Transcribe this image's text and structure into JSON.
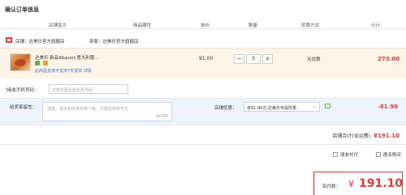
{
  "page": {
    "title": "确认订单信息"
  },
  "table_header": {
    "columns": [
      "店铺宝贝",
      "商品属性",
      "单价",
      "数量",
      "优惠方式",
      "小计"
    ]
  },
  "shop": {
    "store_label": "店铺：达美乐官方旗舰店",
    "seller_label": "卖家：达美乐官方旗舰店"
  },
  "item": {
    "name": "达美乐 新品9&quot;意大利蕾...",
    "return_note": "此商品支持不支持7天退货",
    "return_detail": "详情",
    "unit_price": "91.00",
    "quantity": "3",
    "minus_label": "−",
    "plus_label": "+",
    "promo": "无优惠",
    "subtotal": "273.00"
  },
  "phone": {
    "required_mark": "*",
    "label": "接收手机号码：",
    "placeholder": "仅限中国大陆手机号码"
  },
  "message": {
    "label": "给卖家留言：",
    "placeholder": "选填，请先和商家协商一致，付款后商家可见",
    "count": "0/200"
  },
  "coupon": {
    "label": "店铺优惠：",
    "selected": "省81.90元:达美乐专属优惠",
    "discount": "-81.90"
  },
  "shop_total": {
    "label": "店铺合计(含运费)",
    "amount": "¥191.10"
  },
  "options": {
    "friend_pay": "朋友代付",
    "anonymous": "匿名购买"
  },
  "payment": {
    "label": "实付款：",
    "currency": "¥",
    "amount": "191.10"
  },
  "colors": {
    "accent_red": "#e4393c",
    "item_bg": "#fff4e8",
    "message_bg": "#eef4fd"
  }
}
